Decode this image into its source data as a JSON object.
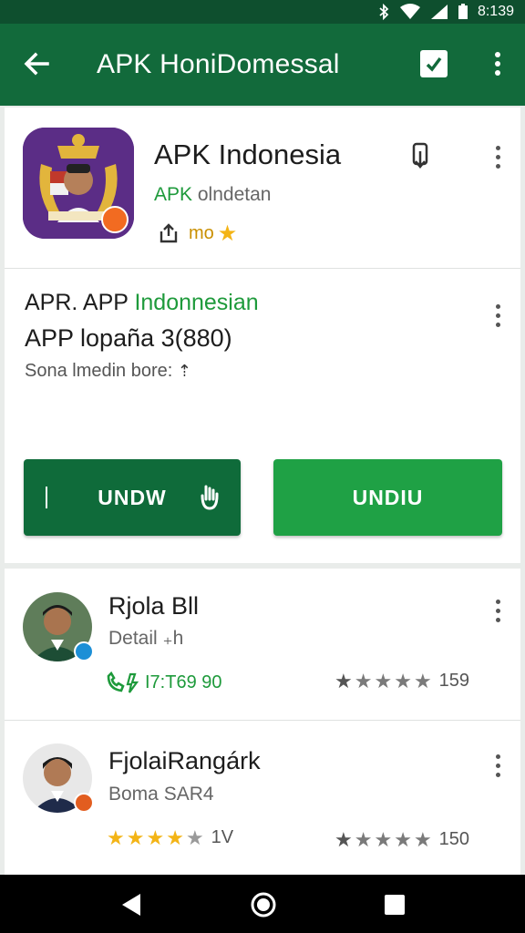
{
  "status_bar": {
    "time": "8:139"
  },
  "app_bar": {
    "title": "APK HoniDomessal"
  },
  "app": {
    "name": "APK Indonesia",
    "developer_prefix": "APK",
    "developer_suffix": " olndetan",
    "meta_text": "mo"
  },
  "description": {
    "line1_prefix": "APR. APP ",
    "line1_highlight": "Indonnesian",
    "line2": "APP lopaña 3(880)",
    "line3": "Sona lmedin bore:"
  },
  "buttons": {
    "left_label": "UNDW",
    "right_label": "UNDIU"
  },
  "reviews": [
    {
      "name": "Rjola Bll",
      "subtitle": "Detail ₊h",
      "meta": "I7:T69 90",
      "rating": 1,
      "count": "159"
    },
    {
      "name": "FjolaiRangárk",
      "subtitle": "Boma SAR4",
      "meta": "1V",
      "rating": 4,
      "count": "150"
    }
  ],
  "colors": {
    "app_bar": "#126a3b",
    "status_bar": "#0e4f2e",
    "accent_green": "#1e9a3b",
    "button_dark": "#0f6b3a",
    "button_light": "#1fa145",
    "star_gold": "#f3b416"
  },
  "icons": {
    "back": "arrow-left-icon",
    "check": "checkbox-icon",
    "more": "more-vert-icon",
    "download": "download-icon",
    "share": "share-icon",
    "star": "star-icon",
    "phone": "phone-icon"
  }
}
